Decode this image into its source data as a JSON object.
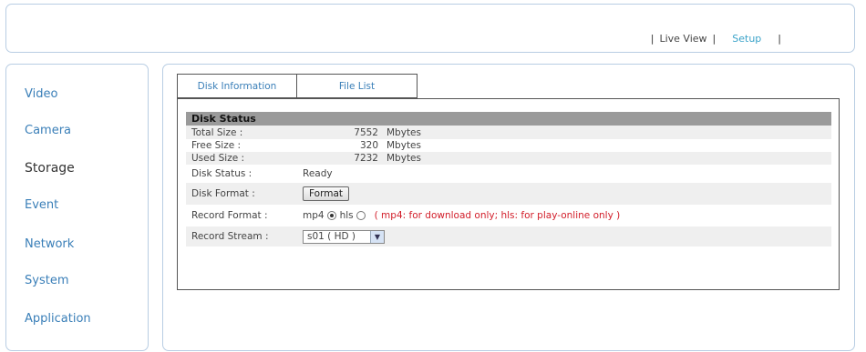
{
  "top_nav": {
    "live_view": "Live View",
    "setup": "Setup",
    "separator": "|"
  },
  "sidebar": {
    "items": [
      {
        "label": "Video"
      },
      {
        "label": "Camera"
      },
      {
        "label": "Storage",
        "active": true
      },
      {
        "label": "Event"
      },
      {
        "label": "Network"
      },
      {
        "label": "System"
      },
      {
        "label": "Application"
      }
    ]
  },
  "tabs": [
    {
      "label": "Disk Information",
      "active": true
    },
    {
      "label": "File List"
    }
  ],
  "disk_status": {
    "header": "Disk Status",
    "total_size": {
      "label": "Total Size :",
      "value": "7552",
      "unit": "Mbytes"
    },
    "free_size": {
      "label": "Free Size :",
      "value": "320",
      "unit": "Mbytes"
    },
    "used_size": {
      "label": "Used Size :",
      "value": "7232",
      "unit": "Mbytes"
    },
    "status": {
      "label": "Disk Status :",
      "value": "Ready"
    },
    "format": {
      "label": "Disk Format :",
      "button": "Format"
    },
    "record_format": {
      "label": "Record Format :",
      "option_mp4": "mp4",
      "option_hls": "hls",
      "selected": "mp4",
      "note": "( mp4: for download only; hls: for play-online only )"
    },
    "record_stream": {
      "label": "Record Stream :",
      "value": "s01 ( HD )"
    }
  },
  "colors": {
    "link": "#3a7fb8",
    "active_link": "#3aa3c9",
    "note": "#d21e2a",
    "header_bg": "#9a9a9a",
    "border": "#b8cde3"
  }
}
